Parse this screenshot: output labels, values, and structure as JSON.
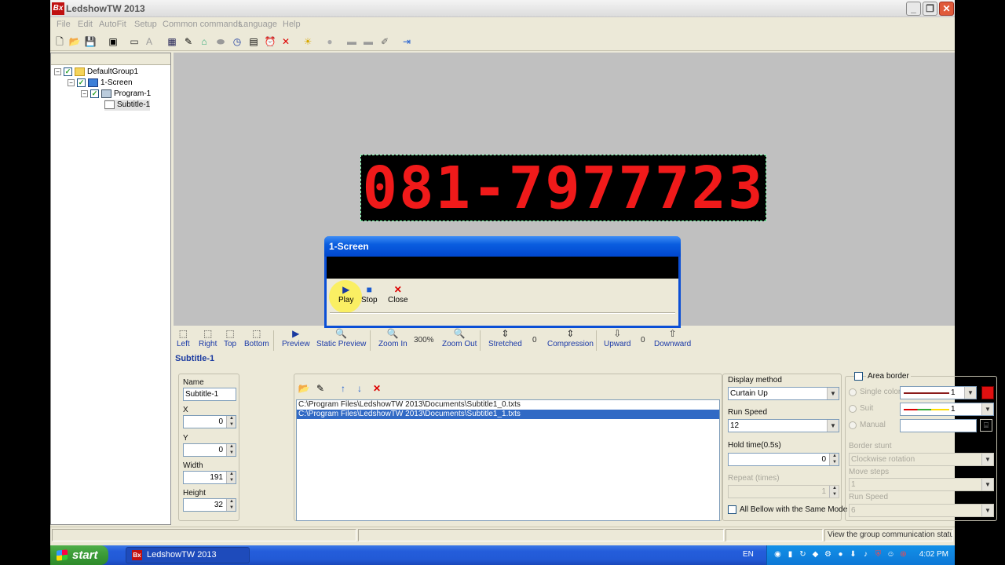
{
  "window": {
    "title": "LedshowTW 2013",
    "logo": "Bx"
  },
  "menu": [
    "File",
    "Edit",
    "AutoFit",
    "Setup",
    "Common commands",
    "Language",
    "Help"
  ],
  "tree": {
    "group": "DefaultGroup1",
    "screen": "1-Screen",
    "program": "Program-1",
    "subtitle": "Subtitle-1"
  },
  "led_text": "081-7977723",
  "dialog": {
    "title": "1-Screen",
    "play": "Play",
    "stop": "Stop",
    "close": "Close"
  },
  "preview_toolbar": {
    "left": "Left",
    "right": "Right",
    "top": "Top",
    "bottom": "Bottom",
    "preview": "Preview",
    "static_preview": "Static Preview",
    "zoom_in": "Zoom In",
    "zoom_value": "300%",
    "zoom_out": "Zoom Out",
    "stretched": "Stretched",
    "stretched_value": "0",
    "compression": "Compression",
    "upward": "Upward",
    "upward_value": "0",
    "downward": "Downward"
  },
  "props": {
    "section_title": "Subtitle-1",
    "name_label": "Name",
    "name_value": "Subtitle-1",
    "x_label": "X",
    "x_value": "0",
    "y_label": "Y",
    "y_value": "0",
    "width_label": "Width",
    "width_value": "191",
    "height_label": "Height",
    "height_value": "32",
    "files": [
      "C:\\Program Files\\LedshowTW 2013\\Documents\\Subtitle1_0.txts",
      "C:\\Program Files\\LedshowTW 2013\\Documents\\Subtitle1_1.txts"
    ],
    "display_method_label": "Display method",
    "display_method_value": "Curtain Up",
    "run_speed_label": "Run Speed",
    "run_speed_value": "12",
    "hold_time_label": "Hold time(0.5s)",
    "hold_time_value": "0",
    "repeat_label": "Repeat (times)",
    "repeat_value": "1",
    "same_mode_label": "All Bellow with the Same Mode",
    "area_border_label": "Area border",
    "single_color_label": "Single color",
    "single_color_value": "1",
    "suit_label": "Suit",
    "suit_value": "1",
    "manual_label": "Manual",
    "border_stunt_label": "Border stunt",
    "border_stunt_value": "Clockwise rotation",
    "move_steps_label": "Move steps",
    "move_steps_value": "1",
    "border_run_speed_label": "Run Speed",
    "border_run_speed_value": "6"
  },
  "status": {
    "message": "View the group communication status"
  },
  "taskbar": {
    "start": "start",
    "task": "LedshowTW 2013",
    "lang": "EN",
    "time": "4:02 PM"
  },
  "colors": {
    "led_red": "#f01a1a",
    "selection": "#316ac5",
    "xp_blue": "#245ddb",
    "border_color": "#e01010"
  }
}
